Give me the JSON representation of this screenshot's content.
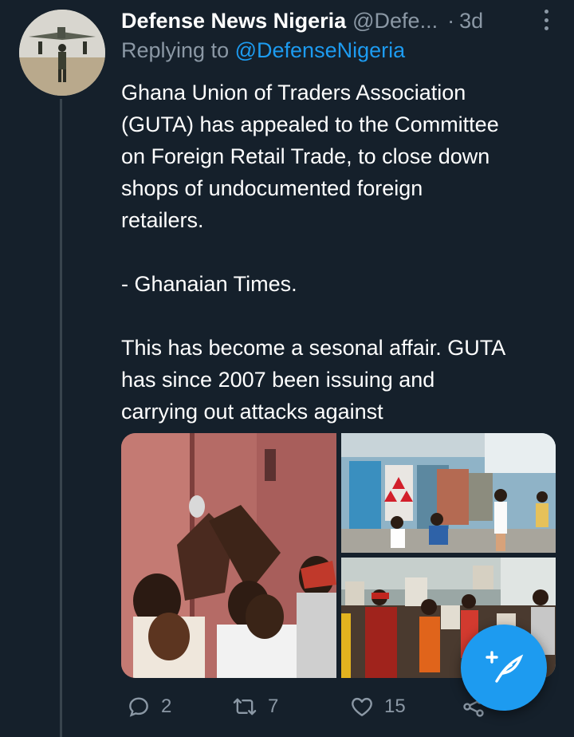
{
  "tweet": {
    "author_name": "Defense News Nigeria",
    "author_handle": "@Defe...",
    "separator": "·",
    "time": "3d",
    "reply_prefix": "Replying to",
    "reply_handle": "@DefenseNigeria",
    "lines": [
      "Ghana Union of Traders Association",
      "(GUTA) has appealed to the Committee",
      "on Foreign Retail Trade, to close down",
      "shops of undocumented foreign",
      "retailers.",
      "",
      "- Ghanaian Times.",
      "",
      "This has become a sesonal affair. GUTA",
      "has since 2007 been issuing and",
      "carrying out attacks against"
    ],
    "media": {
      "count": 3
    }
  },
  "actions": {
    "reply_count": "2",
    "retweet_count": "7",
    "like_count": "15"
  },
  "icons": {
    "more": "more-vertical-icon",
    "reply": "comment-icon",
    "retweet": "retweet-icon",
    "like": "heart-icon",
    "share": "share-icon",
    "compose": "compose-tweet-icon"
  },
  "colors": {
    "background": "#15202b",
    "text": "#ffffff",
    "muted": "#8b98a5",
    "accent": "#1d9bf0",
    "thread_line": "#38444d"
  }
}
